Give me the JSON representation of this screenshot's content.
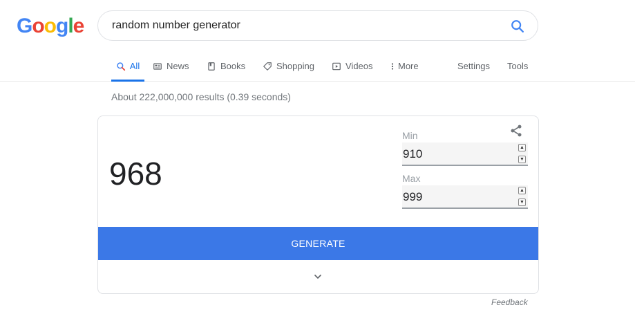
{
  "logo": {
    "text": [
      "G",
      "o",
      "o",
      "g",
      "l",
      "e"
    ]
  },
  "search": {
    "query": "random number generator"
  },
  "tabs": [
    {
      "label": "All",
      "icon": "search-icon",
      "active": true
    },
    {
      "label": "News",
      "icon": "news-icon"
    },
    {
      "label": "Books",
      "icon": "books-icon"
    },
    {
      "label": "Shopping",
      "icon": "tag-icon"
    },
    {
      "label": "Videos",
      "icon": "play-icon"
    },
    {
      "label": "More",
      "icon": "more-vert-icon"
    },
    {
      "label": "Settings"
    },
    {
      "label": "Tools"
    }
  ],
  "result_stats": "About 222,000,000 results (0.39 seconds)",
  "rng": {
    "result": "968",
    "min_label": "Min",
    "min_value": "910",
    "max_label": "Max",
    "max_value": "999",
    "generate_label": "GENERATE"
  },
  "feedback_label": "Feedback",
  "colors": {
    "accent": "#1a73e8",
    "generate_button": "#3b78e7"
  }
}
